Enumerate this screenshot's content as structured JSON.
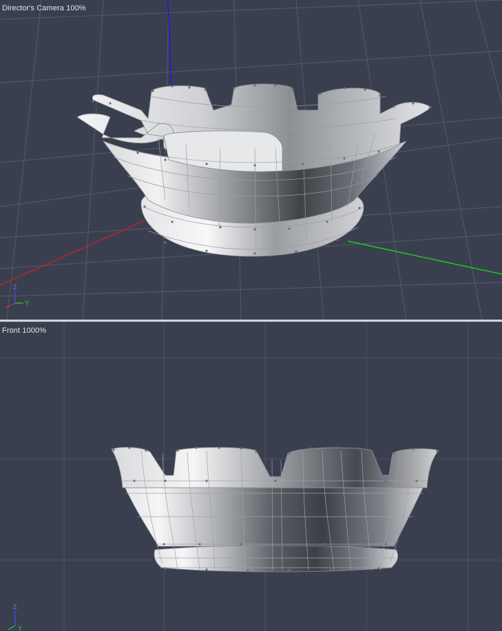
{
  "viewports": {
    "top": {
      "label": "Director's Camera 100%",
      "camera": "Director's Camera",
      "zoom": "100%"
    },
    "bottom": {
      "label": "Front 1000%",
      "camera": "Front",
      "zoom": "1000%"
    }
  },
  "axis_triad": {
    "z_label": "Z",
    "y_label": "Y",
    "x_label": "X"
  },
  "colors": {
    "viewport_bg": "#3a3f4f",
    "grid": "#5a6070",
    "x_axis": "#c8202e",
    "y_axis": "#1fd01f",
    "z_axis": "#1a1ad8",
    "model_light": "#e8e8ea",
    "model_dark": "#555a60",
    "wire": "#b8b8b8"
  }
}
